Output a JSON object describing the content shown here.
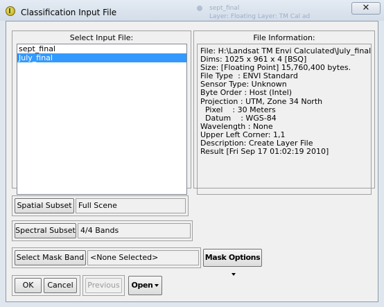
{
  "window": {
    "title": "Classification Input File",
    "close_glyph": "✕"
  },
  "background_window": {
    "line1": "sept_final",
    "line2": "Layer: Floating Layer: TM Cal ad"
  },
  "input_panel": {
    "title": "Select Input File:",
    "files": [
      {
        "label": "sept_final",
        "selected": false
      },
      {
        "label": "July_final",
        "selected": true
      }
    ]
  },
  "info_panel": {
    "title": "File Information:",
    "lines": [
      "File: H:\\Landsat TM Envi Calculated\\July_final",
      "Dims: 1025 x 961 x 4 [BSQ]",
      "Size: [Floating Point] 15,760,400 bytes.",
      "File Type  : ENVI Standard",
      "Sensor Type: Unknown",
      "Byte Order : Host (Intel)",
      "Projection : UTM, Zone 34 North",
      "  Pixel    : 30 Meters",
      "  Datum    : WGS-84",
      "Wavelength : None",
      "Upper Left Corner: 1,1",
      "Description: Create Layer File",
      "Result [Fri Sep 17 01:02:19 2010]"
    ]
  },
  "spatial_subset": {
    "button": "Spatial Subset",
    "value": "Full Scene"
  },
  "spectral_subset": {
    "button": "Spectral Subset",
    "value": "4/4 Bands"
  },
  "mask": {
    "button": "Select Mask Band",
    "value": "<None Selected>",
    "options_button": "Mask Options"
  },
  "footer": {
    "ok": "OK",
    "cancel": "Cancel",
    "previous": "Previous",
    "open": "Open"
  },
  "colors": {
    "selection": "#3399ff",
    "dialog_bg": "#f0f0f0",
    "titlebar": "#dbe3ec"
  }
}
